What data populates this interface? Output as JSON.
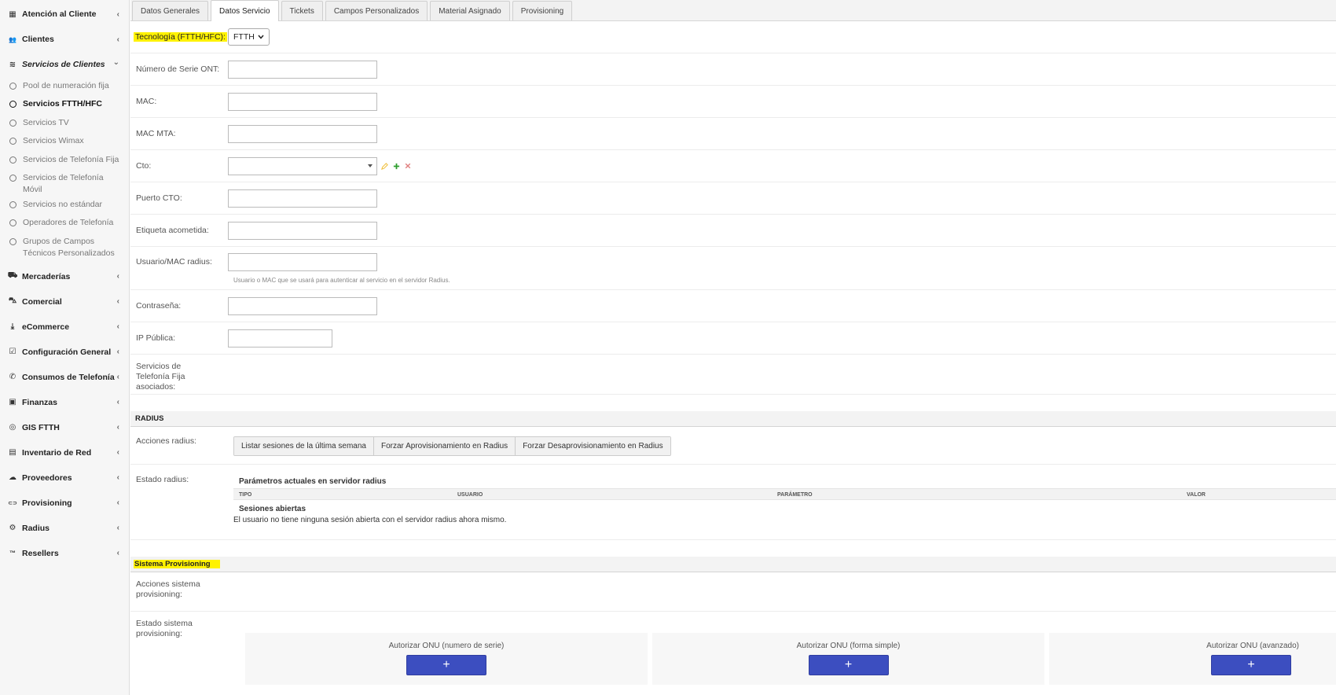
{
  "sidebar": {
    "items": [
      {
        "label": "Atención al Cliente",
        "icon": "calendar-icon",
        "glyph": "▦"
      },
      {
        "label": "Clientes",
        "icon": "users-icon",
        "glyph": "👥"
      },
      {
        "label": "Servicios de Clientes",
        "icon": "wifi-icon",
        "glyph": "≋"
      }
    ],
    "submenu": [
      {
        "label": "Pool de numeración fija"
      },
      {
        "label": "Servicios FTTH/HFC"
      },
      {
        "label": "Servicios TV"
      },
      {
        "label": "Servicios Wimax"
      },
      {
        "label": "Servicios de Telefonía Fija"
      },
      {
        "label": "Servicios de Telefonía Móvil"
      },
      {
        "label": "Servicios no estándar"
      },
      {
        "label": "Operadores de Telefonía"
      },
      {
        "label": "Grupos de Campos Técnicos Personalizados"
      }
    ],
    "items_after": [
      {
        "label": "Mercaderías",
        "icon": "truck-icon",
        "glyph": "⛟"
      },
      {
        "label": "Comercial",
        "icon": "cart-icon",
        "glyph": "⛍"
      },
      {
        "label": "eCommerce",
        "icon": "download-icon",
        "glyph": "⤓"
      },
      {
        "label": "Configuración General",
        "icon": "check-square-icon",
        "glyph": "☑"
      },
      {
        "label": "Consumos de Telefonía",
        "icon": "phone-icon",
        "glyph": "✆"
      },
      {
        "label": "Finanzas",
        "icon": "money-icon",
        "glyph": "▣"
      },
      {
        "label": "GIS FTTH",
        "icon": "globe-icon",
        "glyph": "◎"
      },
      {
        "label": "Inventario de Red",
        "icon": "map-icon",
        "glyph": "▤"
      },
      {
        "label": "Proveedores",
        "icon": "cloud-icon",
        "glyph": "☁"
      },
      {
        "label": "Provisioning",
        "icon": "toggle-icon",
        "glyph": "⊂⊃"
      },
      {
        "label": "Radius",
        "icon": "user-gear-icon",
        "glyph": "⚙"
      },
      {
        "label": "Resellers",
        "icon": "trademark-icon",
        "glyph": "™"
      }
    ],
    "chevron_closed": "‹",
    "chevron_open": "⌄"
  },
  "tabs": [
    {
      "label": "Datos Generales"
    },
    {
      "label": "Datos Servicio"
    },
    {
      "label": "Tickets"
    },
    {
      "label": "Campos Personalizados"
    },
    {
      "label": "Material Asignado"
    },
    {
      "label": "Provisioning"
    }
  ],
  "form": {
    "tecnologia_label": "Tecnología (FTTH/HFC):",
    "tecnologia_value": "FTTH",
    "serie_ont_label": "Número de Serie ONT:",
    "mac_label": "MAC:",
    "mac_mta_label": "MAC MTA:",
    "cto_label": "Cto:",
    "puerto_cto_label": "Puerto CTO:",
    "etiqueta_label": "Etiqueta acometida:",
    "usuario_label": "Usuario/MAC radius:",
    "usuario_help": "Usuario o MAC que se usará para autenticar al servicio en el servidor Radius.",
    "contrasena_label": "Contraseña:",
    "ip_label": "IP Pública:",
    "telefonia_label": "Servicios de Telefonía Fija asociados:"
  },
  "radius": {
    "section_title": "RADIUS",
    "acciones_label": "Acciones radius:",
    "buttons": [
      {
        "label": "Listar sesiones de la última semana"
      },
      {
        "label": "Forzar Aprovisionamiento en Radius"
      },
      {
        "label": "Forzar Desaprovisionamiento en Radius"
      }
    ],
    "estado_label": "Estado radius:",
    "params_title": "Parámetros actuales en servidor radius",
    "columns": [
      "TIPO",
      "USUARIO",
      "PARÁMETRO",
      "VALOR"
    ],
    "sessions_title": "Sesiones abiertas",
    "sessions_message": "El usuario no tiene ninguna sesión abierta con el servidor radius ahora mismo."
  },
  "provisioning": {
    "section_title": "Sistema Provisioning",
    "acciones_label": "Acciones sistema provisioning:",
    "estado_label": "Estado sistema provisioning:",
    "cards": [
      {
        "title": "Autorizar ONU (numero de serie)",
        "button": "+"
      },
      {
        "title": "Autorizar ONU (forma simple)",
        "button": "+"
      },
      {
        "title": "Autorizar ONU (avanzado)",
        "button": "+"
      }
    ]
  },
  "colors": {
    "highlight": "#fff200",
    "primary_button": "#3c4ec0",
    "edit_icon": "#f0c040",
    "add_icon": "#2e9e2e",
    "remove_icon": "#e08080"
  }
}
